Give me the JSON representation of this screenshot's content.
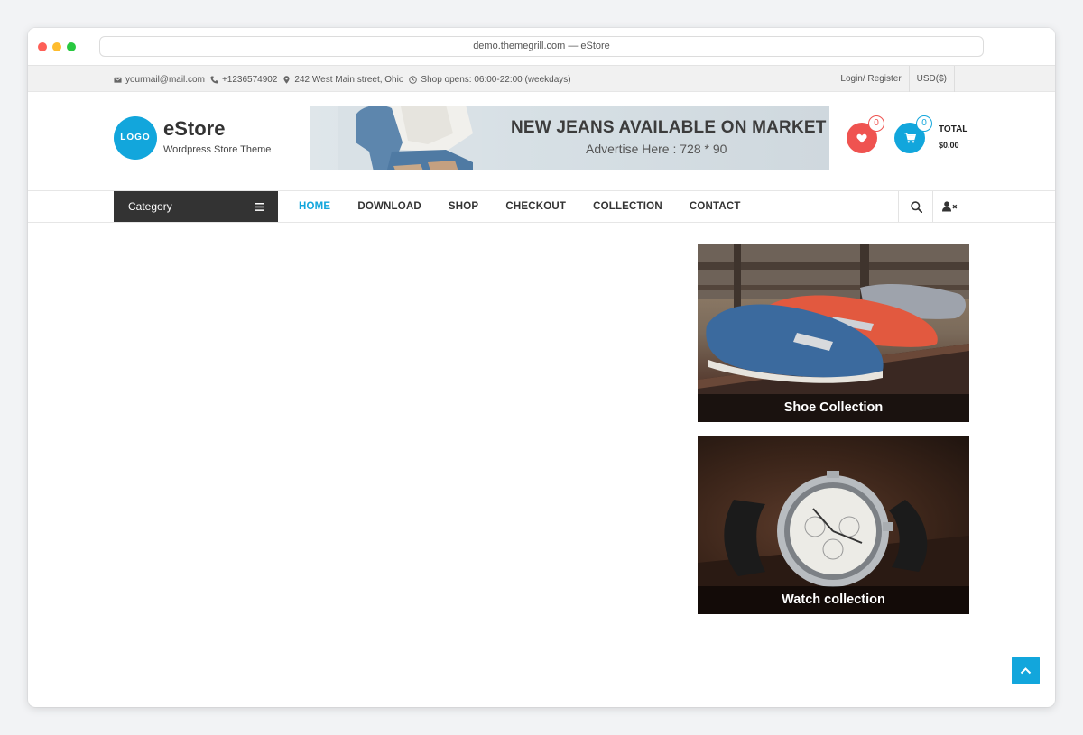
{
  "browser": {
    "url": "demo.themegrill.com — eStore"
  },
  "topbar": {
    "email": "yourmail@mail.com",
    "phone": "+1236574902",
    "address": "242 West Main street, Ohio",
    "hours": "Shop opens: 06:00-22:00 (weekdays)",
    "login": "Login/ Register",
    "currency": "USD($)"
  },
  "header": {
    "logo_text": "LOGO",
    "site_title": "eStore",
    "tagline": "Wordpress Store Theme",
    "banner_headline": "NEW JEANS AVAILABLE ON MARKET",
    "banner_sub": "Advertise Here : 728 * 90",
    "wishlist_count": "0",
    "cart_count": "0",
    "total_label": "TOTAL",
    "total_value": "$0.00"
  },
  "nav": {
    "category_label": "Category",
    "items": [
      "HOME",
      "DOWNLOAD",
      "SHOP",
      "CHECKOUT",
      "COLLECTION",
      "CONTACT"
    ]
  },
  "collections": [
    {
      "caption": "Shoe Collection"
    },
    {
      "caption": "Watch collection"
    }
  ],
  "colors": {
    "accent": "#12a6dc",
    "wishlist": "#ef5350",
    "dark": "#333333"
  }
}
